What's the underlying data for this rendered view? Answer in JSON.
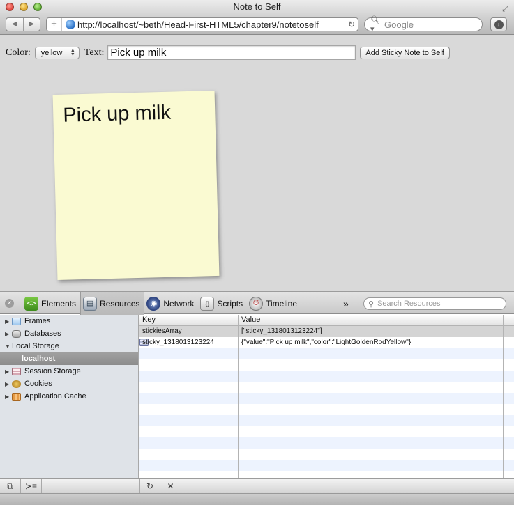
{
  "window": {
    "title": "Note to Self"
  },
  "browser": {
    "url": "http://localhost/~beth/Head-First-HTML5/chapter9/notetoself",
    "search_placeholder": "Google"
  },
  "page": {
    "color_label": "Color:",
    "color_selected": "yellow",
    "text_label": "Text:",
    "text_value": "Pick up milk",
    "add_button": "Add Sticky Note to Self",
    "sticky": {
      "text": "Pick up milk",
      "color": "#fafad2"
    }
  },
  "inspector": {
    "tabs": [
      {
        "label": "Elements",
        "icon": "elements-icon"
      },
      {
        "label": "Resources",
        "icon": "resources-icon"
      },
      {
        "label": "Network",
        "icon": "network-icon"
      },
      {
        "label": "Scripts",
        "icon": "scripts-icon"
      },
      {
        "label": "Timeline",
        "icon": "timeline-icon"
      }
    ],
    "more": "»",
    "search_placeholder": "Search Resources",
    "sidebar": [
      {
        "label": "Frames",
        "icon": "folder-icon"
      },
      {
        "label": "Databases",
        "icon": "database-icon"
      },
      {
        "label": "Local Storage",
        "icon": "local-storage-icon"
      },
      {
        "label": "localhost",
        "icon": "local-storage-icon"
      },
      {
        "label": "Session Storage",
        "icon": "session-storage-icon"
      },
      {
        "label": "Cookies",
        "icon": "cookies-icon"
      },
      {
        "label": "Application Cache",
        "icon": "app-cache-icon"
      }
    ],
    "table": {
      "headers": [
        "Key",
        "Value"
      ],
      "rows": [
        {
          "key": "stickiesArray",
          "value": "[\"sticky_1318013123224\"]"
        },
        {
          "key": "sticky_1318013123224",
          "value": "{\"value\":\"Pick up milk\",\"color\":\"LightGoldenRodYellow\"}"
        }
      ]
    }
  }
}
